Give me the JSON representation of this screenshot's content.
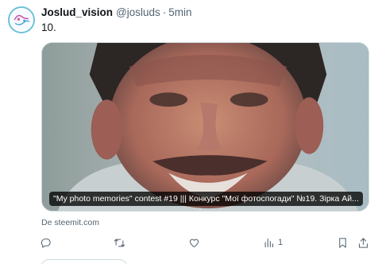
{
  "post": {
    "author_name": "Joslud_vision",
    "handle": "@josluds",
    "separator": "·",
    "time": "5min",
    "text": "10."
  },
  "card": {
    "title": "\"My photo memories\" contest #19 ||| Конкурс \"Мої фотоспогади\" №19. Зірка Ай...",
    "source": "De steemit.com"
  },
  "actions": {
    "reply_icon": "reply-icon",
    "retweet_icon": "retweet-icon",
    "like_icon": "heart-icon",
    "views_icon": "views-icon",
    "views_count": "1",
    "bookmark_icon": "bookmark-icon",
    "share_icon": "share-icon"
  },
  "colors": {
    "text_primary": "#0f1419",
    "text_secondary": "#536471",
    "border": "#cfd9de",
    "avatar_ring": "#6ec1d8"
  }
}
